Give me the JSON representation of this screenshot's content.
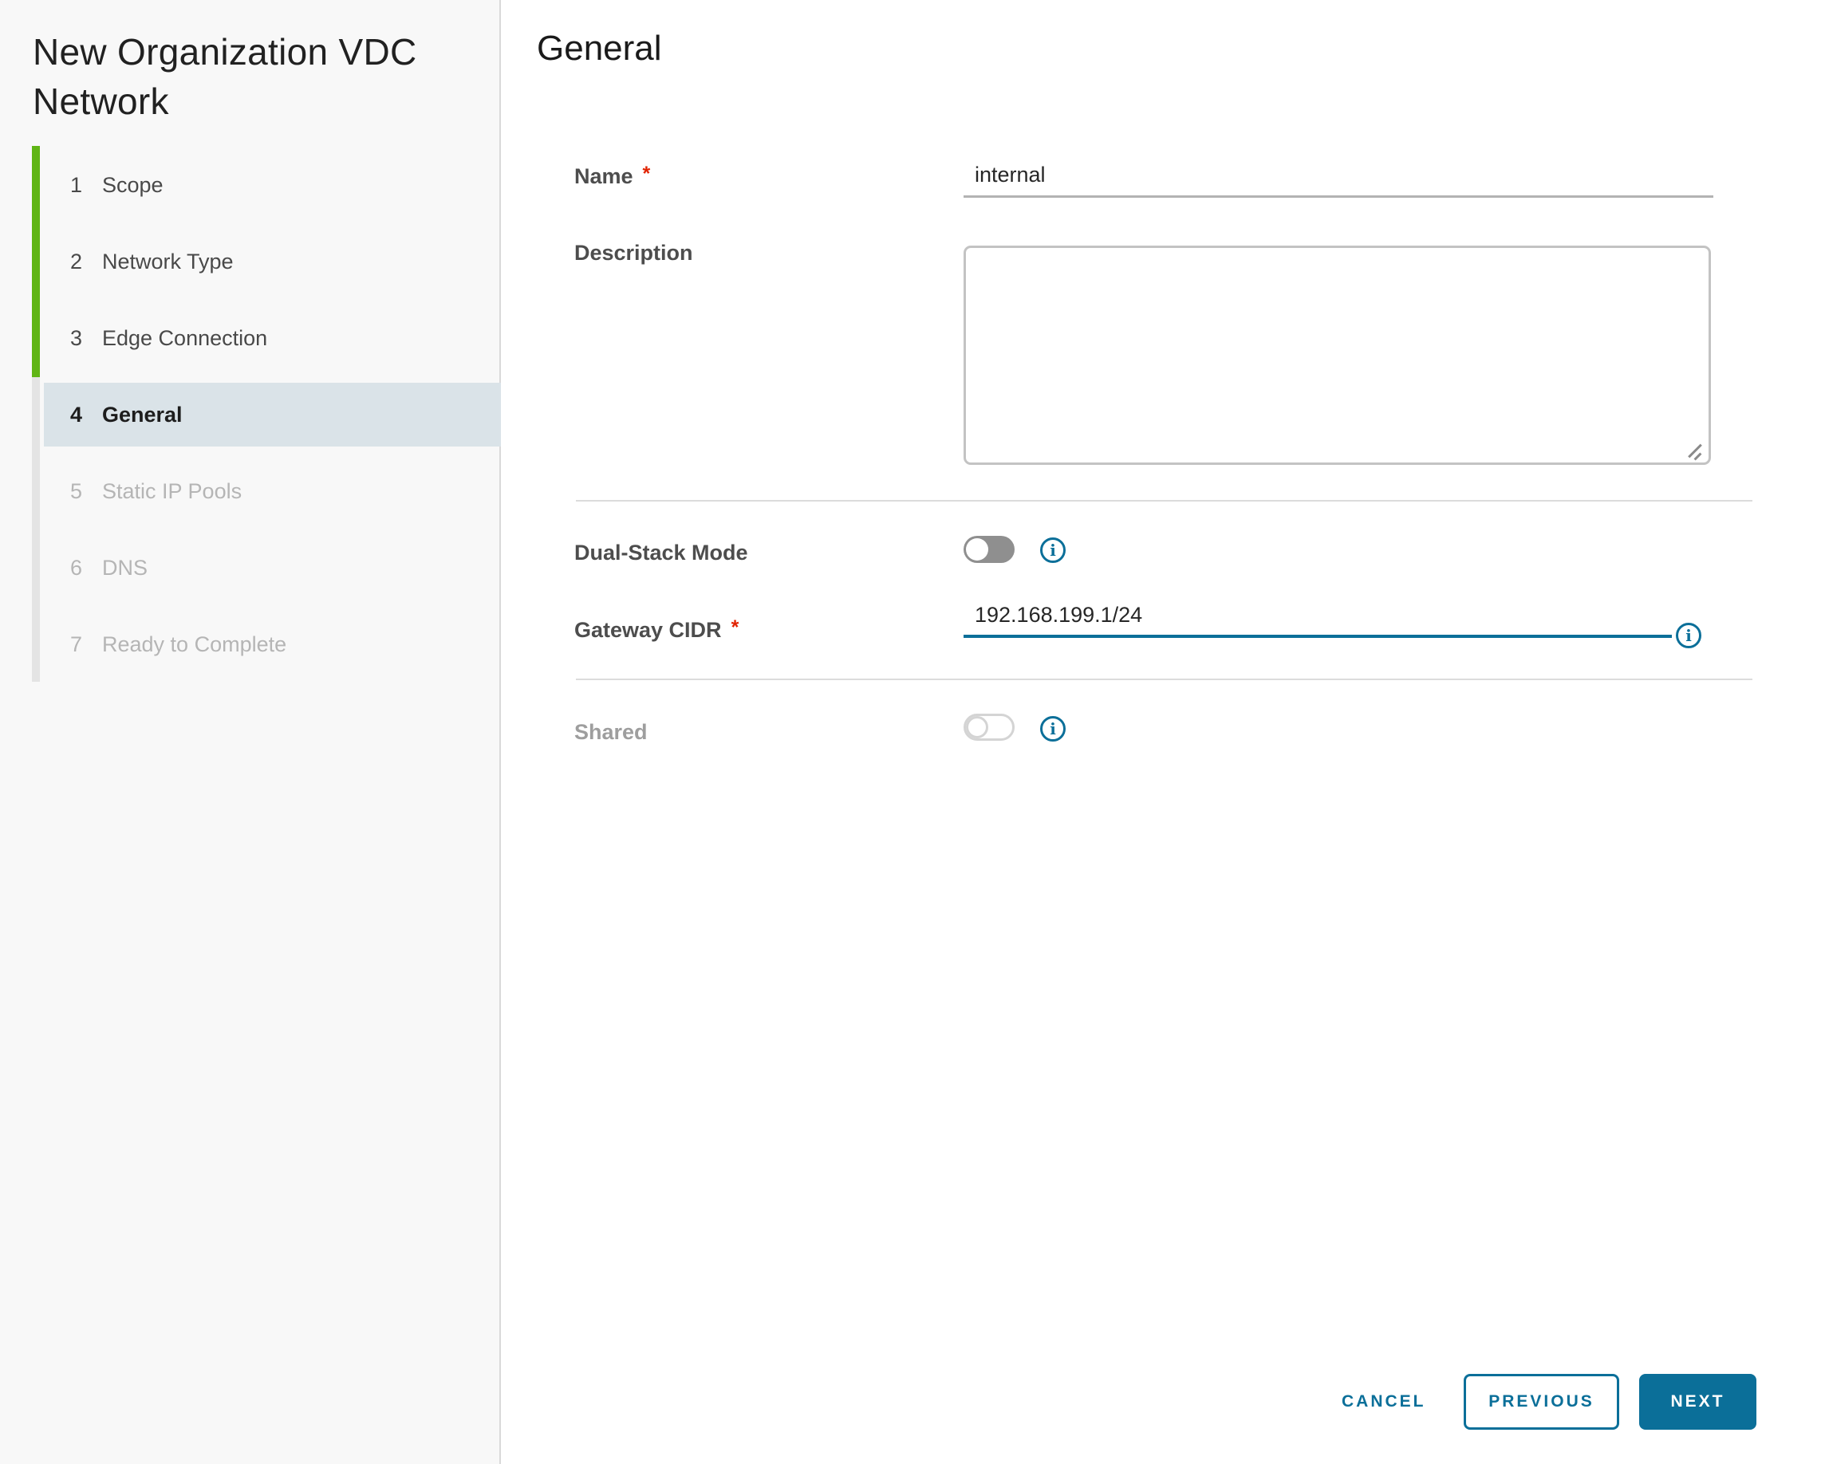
{
  "sidebar": {
    "title": "New Organization VDC Network",
    "steps": [
      {
        "num": "1",
        "label": "Scope",
        "state": "done"
      },
      {
        "num": "2",
        "label": "Network Type",
        "state": "done"
      },
      {
        "num": "3",
        "label": "Edge Connection",
        "state": "done"
      },
      {
        "num": "4",
        "label": "General",
        "state": "active"
      },
      {
        "num": "5",
        "label": "Static IP Pools",
        "state": "upcoming"
      },
      {
        "num": "6",
        "label": "DNS",
        "state": "upcoming"
      },
      {
        "num": "7",
        "label": "Ready to Complete",
        "state": "upcoming"
      }
    ]
  },
  "content": {
    "heading": "General",
    "name_field": {
      "label": "Name",
      "required_marker": "*",
      "value": "internal"
    },
    "description_field": {
      "label": "Description",
      "value": ""
    },
    "dual_stack": {
      "label": "Dual-Stack Mode",
      "state": "off"
    },
    "gateway_cidr": {
      "label": "Gateway CIDR",
      "required_marker": "*",
      "value": "192.168.199.1/24"
    },
    "shared": {
      "label": "Shared",
      "state": "off",
      "disabled": true
    },
    "info_glyph": "i"
  },
  "footer": {
    "cancel_label": "CANCEL",
    "previous_label": "PREVIOUS",
    "next_label": "NEXT"
  },
  "colors": {
    "accent_blue": "#0b6f99",
    "progress_green": "#60b515",
    "active_step_bg": "#dae3e8",
    "required_red": "#e12200",
    "toggle_off_gray": "#8f8f8f"
  }
}
